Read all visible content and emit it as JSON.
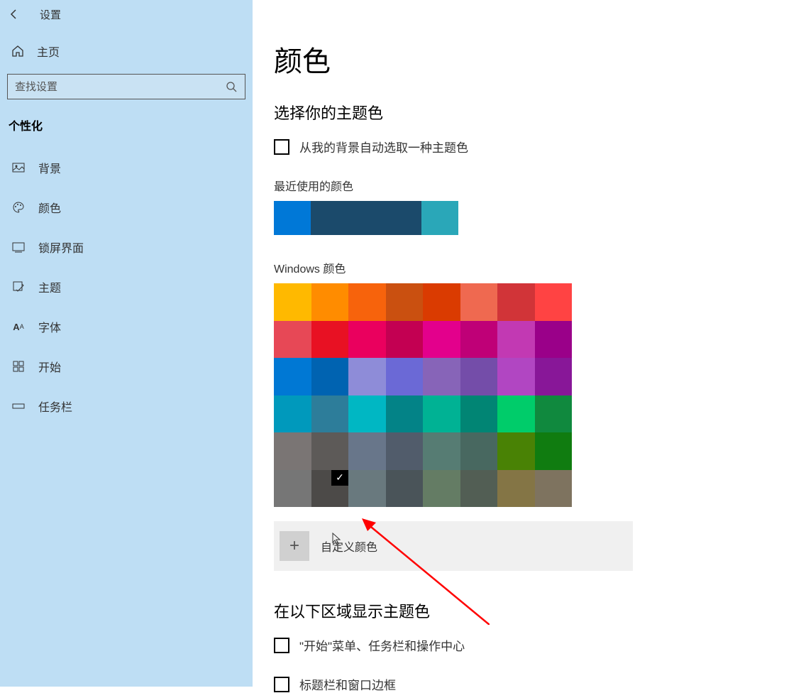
{
  "header": {
    "app_title": "设置"
  },
  "home_label": "主页",
  "search_placeholder": "查找设置",
  "category": "个性化",
  "nav": [
    {
      "label": "背景"
    },
    {
      "label": "颜色"
    },
    {
      "label": "锁屏界面"
    },
    {
      "label": "主题"
    },
    {
      "label": "字体"
    },
    {
      "label": "开始"
    },
    {
      "label": "任务栏"
    }
  ],
  "page_title": "颜色",
  "accent_heading": "选择你的主题色",
  "auto_pick_label": "从我的背景自动选取一种主题色",
  "recent_label": "最近使用的颜色",
  "recent_colors": [
    "#0078d7",
    "#1b4a6b",
    "#1b4a6b",
    "#1b4a6b",
    "#2aa7b8"
  ],
  "windows_label": "Windows 颜色",
  "grid_colors": [
    "#ffb900",
    "#ff8c00",
    "#f7630c",
    "#ca5010",
    "#da3b01",
    "#ef6950",
    "#d13438",
    "#ff4343",
    "#e74856",
    "#e81123",
    "#ea005e",
    "#c30052",
    "#e3008c",
    "#bf0077",
    "#c239b3",
    "#9a0089",
    "#0078d4",
    "#0063b1",
    "#8e8cd8",
    "#6b69d6",
    "#8764b8",
    "#744da9",
    "#b146c2",
    "#881798",
    "#0099bc",
    "#2d7d9a",
    "#00b7c3",
    "#038387",
    "#00b294",
    "#018574",
    "#00cc6a",
    "#10893e",
    "#7a7574",
    "#5d5a58",
    "#68768a",
    "#515c6b",
    "#567c73",
    "#486860",
    "#498205",
    "#107c10",
    "#767676",
    "#4c4a48",
    "#69797e",
    "#4a5459",
    "#647c64",
    "#525e54",
    "#847545",
    "#7e735f"
  ],
  "selected_index": 41,
  "custom_label": "自定义颜色",
  "show_accent_heading": "在以下区域显示主题色",
  "show_start_label": "\"开始\"菜单、任务栏和操作中心",
  "show_title_label": "标题栏和窗口边框"
}
